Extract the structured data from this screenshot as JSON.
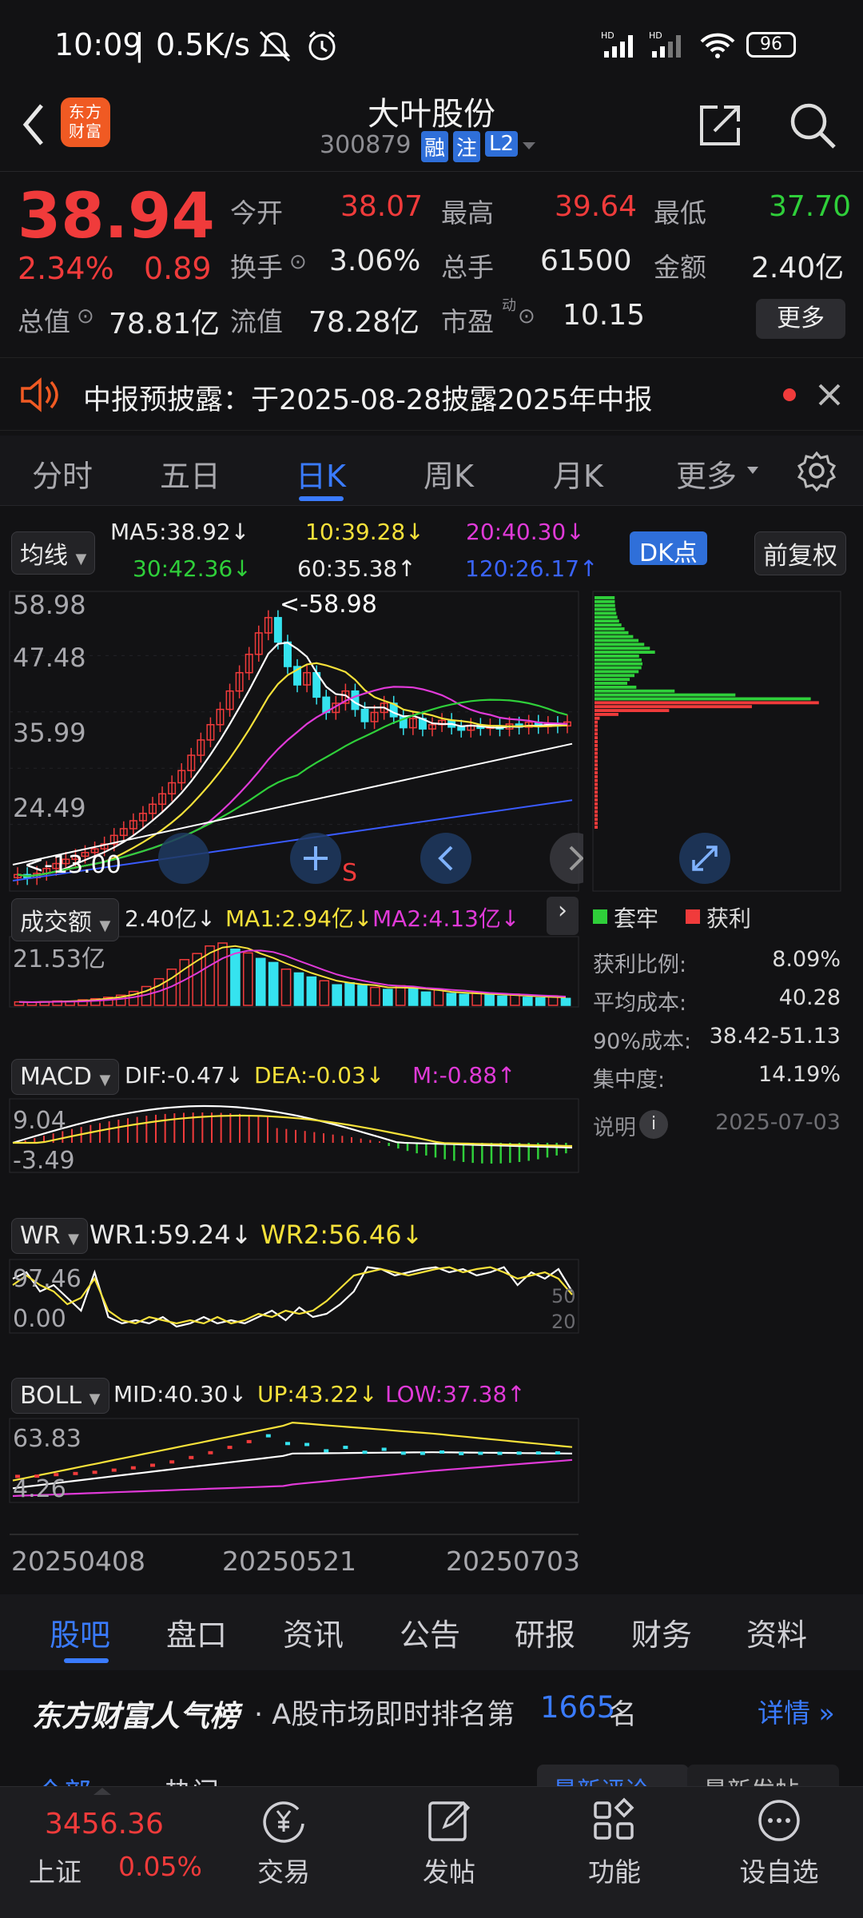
{
  "status": {
    "time": "10:09",
    "speed": "0.5K/s",
    "battery": "96"
  },
  "header": {
    "title": "大叶股份",
    "code": "300879",
    "badges": [
      "融",
      "注",
      "L2"
    ],
    "logo_text": "东方财富"
  },
  "quote": {
    "price": "38.94",
    "change_pct": "2.34%",
    "change": "0.89",
    "open_label": "今开",
    "open": "38.07",
    "high_label": "最高",
    "high": "39.64",
    "low_label": "最低",
    "low": "37.70",
    "turnover_label": "换手",
    "turnover": "3.06%",
    "volume_label": "总手",
    "volume": "61500",
    "amount_label": "金额",
    "amount": "2.40亿",
    "mktcap_label": "总值",
    "mktcap": "78.81亿",
    "float_label": "流值",
    "float_cap": "78.28亿",
    "pe_label": "市盈",
    "pe_sup": "动",
    "pe": "10.15",
    "more_label": "更多"
  },
  "notice": {
    "text": "中报预披露：于2025-08-28披露2025年中报"
  },
  "period_tabs": [
    "分时",
    "五日",
    "日K",
    "周K",
    "月K",
    "更多"
  ],
  "active_period": 2,
  "ma_bar": {
    "selector": "均线",
    "ma5": "MA5:38.92",
    "ma10": "10:39.28",
    "ma20": "20:40.30",
    "ma30": "30:42.36",
    "ma60": "60:35.38",
    "ma120": "120:26.17",
    "dk_label": "DK点",
    "adjust_label": "前复权"
  },
  "colors": {
    "up": "#f03b3b",
    "down": "#2fcf3a",
    "accent": "#3a7bff",
    "ma5": "#ffffff",
    "ma10": "#f6e13a",
    "ma20": "#e03ad8",
    "ma30": "#2fcf3a",
    "ma120": "#3a5bff",
    "volume_down": "#35e3ef"
  },
  "kline": {
    "yticks": [
      "58.98",
      "47.48",
      "35.99",
      "24.49",
      "13.00"
    ],
    "max_label": "<-58.98",
    "min_label": "<-13.00",
    "marker_s": "S",
    "chart_data": {
      "type": "candlestick",
      "ylim": [
        13.0,
        58.98
      ],
      "x_dates": [
        "20250408",
        "20250521",
        "20250703"
      ],
      "close": [
        14,
        13.5,
        14.2,
        15,
        15.8,
        16.5,
        17,
        17.6,
        18.2,
        19,
        20.4,
        21.5,
        22.8,
        24,
        25.5,
        27.2,
        29,
        31,
        33.5,
        36,
        38.5,
        41,
        44,
        47,
        50,
        53.5,
        56,
        52,
        48,
        45,
        47,
        43,
        40.5,
        42,
        44,
        41,
        39,
        40.5,
        42,
        39.8,
        38,
        39.5,
        37.8,
        38.5,
        39.2,
        38.1,
        37.6,
        38.4,
        37.9,
        38.3,
        37.8,
        38.6,
        38.1,
        38.9,
        38.2,
        38.7,
        38.3,
        38.94
      ]
    }
  },
  "volume": {
    "selector": "成交额",
    "v": "2.40亿",
    "ma1": "MA1:2.94亿",
    "ma2": "MA2:4.13亿",
    "ytick": "21.53亿",
    "chart_data": {
      "type": "bar",
      "values": [
        1.2,
        1.0,
        1.3,
        1.5,
        1.4,
        1.9,
        2.3,
        2.8,
        3.5,
        4.8,
        6.5,
        9.2,
        12.5,
        15.8,
        17.9,
        20.5,
        21.53,
        19.4,
        18.1,
        16.2,
        14.8,
        12.5,
        11.2,
        9.8,
        8.5,
        7.1,
        7.8,
        6.9,
        6.2,
        5.5,
        6.8,
        5.9,
        4.6,
        5.3,
        4.1,
        3.8,
        4.5,
        3.6,
        3.2,
        3.9,
        2.8,
        2.6,
        3.3,
        2.4
      ],
      "down": [
        false,
        false,
        false,
        false,
        false,
        false,
        false,
        false,
        false,
        false,
        false,
        false,
        false,
        false,
        false,
        false,
        false,
        true,
        false,
        true,
        true,
        false,
        true,
        true,
        false,
        true,
        true,
        true,
        false,
        true,
        false,
        true,
        true,
        false,
        true,
        true,
        false,
        true,
        true,
        false,
        true,
        true,
        false,
        true
      ]
    }
  },
  "macd": {
    "selector": "MACD",
    "dif": "DIF:-0.47",
    "dea": "DEA:-0.03",
    "m": "M:-0.88",
    "yticks": [
      "9.04",
      "-3.49"
    ]
  },
  "wr": {
    "selector": "WR",
    "wr1": "WR1:59.24",
    "wr2": "WR2:56.46",
    "yticks": [
      "97.46",
      "0.00"
    ],
    "right_ticks": [
      "50",
      "20"
    ]
  },
  "boll": {
    "selector": "BOLL",
    "mid": "MID:40.30",
    "up": "UP:43.22",
    "low": "LOW:37.38",
    "yticks": [
      "63.83",
      "4.26"
    ]
  },
  "x_axis": [
    "20250408",
    "20250521",
    "20250703"
  ],
  "chip": {
    "legend_trap": "套牢",
    "legend_profit": "获利",
    "rows": [
      {
        "label": "获利比例:",
        "value": "8.09%"
      },
      {
        "label": "平均成本:",
        "value": "40.28"
      },
      {
        "label": "90%成本:",
        "value": "38.42-51.13"
      },
      {
        "label": "集中度:",
        "value": "14.19%"
      }
    ],
    "note_label": "说明",
    "date": "2025-07-03"
  },
  "info_tabs": [
    "股吧",
    "盘口",
    "资讯",
    "公告",
    "研报",
    "财务",
    "资料"
  ],
  "rank": {
    "brand": "东方财富人气榜",
    "prefix": "· A股市场即时排名第",
    "number": "1665",
    "suffix": "名",
    "detail": "详情"
  },
  "peek": {
    "tab1": "全部",
    "tab2": "热门",
    "btn1": "最新评论",
    "btn2": "最新发帖"
  },
  "bottom": {
    "index_value": "3456.36",
    "index_name": "上证",
    "index_pct": "0.05%",
    "items": [
      "交易",
      "发帖",
      "功能",
      "设自选"
    ]
  }
}
